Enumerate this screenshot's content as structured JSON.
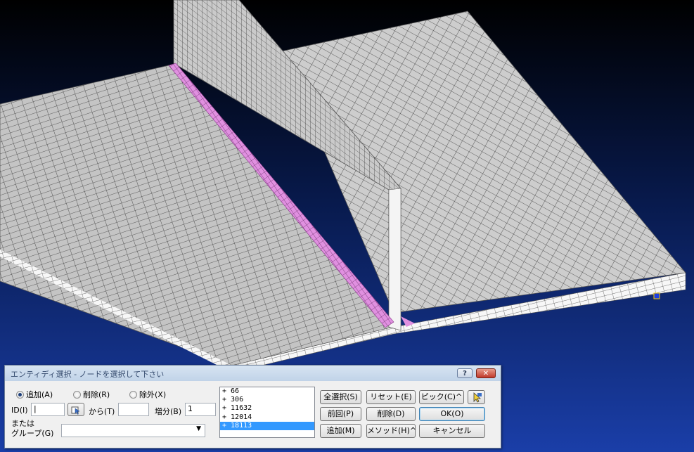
{
  "dialog": {
    "title": "エンティディ選択 - ノードを選択して下さい",
    "help_label": "?",
    "close_label": "✕",
    "mode_radios": [
      {
        "label": "追加(A)",
        "selected": true
      },
      {
        "label": "削除(R)",
        "selected": false
      },
      {
        "label": "除外(X)",
        "selected": false
      }
    ],
    "id_label": "ID(I)",
    "id_value": "|",
    "from_label": "から(T)",
    "from_value": "",
    "increment_label": "増分(B)",
    "increment_value": "1",
    "or_label": "または",
    "group_label": "グループ(G)",
    "group_value": "",
    "id_list": [
      "+ 66",
      "+ 306",
      "+ 11632",
      "+ 12014",
      "+ 18113"
    ],
    "selected_index": 4,
    "buttons": {
      "select_all": "全選択(S)",
      "reset": "リセット(E)",
      "pick": "ピック(C)^",
      "previous": "前回(P)",
      "delete": "削除(D)",
      "ok": "OK(O)",
      "add": "追加(M)",
      "method": "メソッド(H)^",
      "cancel": "キャンセル"
    }
  },
  "colors": {
    "background_top": "#000000",
    "background_bottom": "#1a3ea8",
    "mesh_face": "#c8c8c8",
    "mesh_line": "#3c3c3c",
    "weld_highlight": "#e090e0",
    "dialog_title": "#354b6e"
  },
  "icons": {
    "id_picker": "pointer-pick-icon",
    "pick_mode": "cursor-arrow-icon",
    "dropdown": "chevron-down-icon"
  }
}
